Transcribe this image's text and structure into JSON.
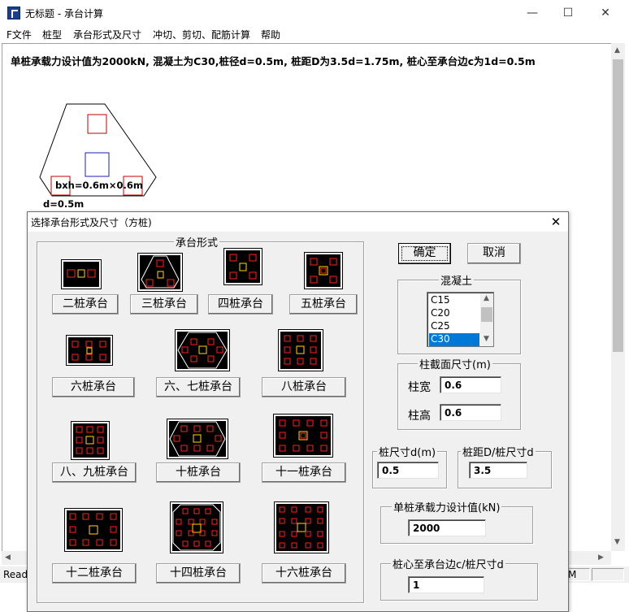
{
  "window": {
    "title": "无标题 - 承台计算",
    "minimize": "—",
    "maximize": "☐",
    "close": "✕"
  },
  "menu": [
    "F文件",
    "桩型",
    "承台形式及尺寸",
    "冲切、剪切、配筋计算",
    "帮助"
  ],
  "info_line": "单桩承载力设计值为2000kN, 混凝土为C30,桩径d=0.5m, 桩距D为3.5d=1.75m, 桩心至承台边c为1d=0.5m",
  "drawing": {
    "column_label": "bxh=0.6m×0.6m",
    "d_label": "d=0.5m",
    "colors": {
      "pile": "#c00000",
      "column": "#1c1cb4",
      "outline": "#000000"
    }
  },
  "statusbar": {
    "text": "Read",
    "cell_text": "M"
  },
  "dialog": {
    "title": "选择承台形式及尺寸（方桩)",
    "close": "✕",
    "group_cap_type": "承台形式",
    "cap_buttons": [
      "二桩承台",
      "三桩承台",
      "四桩承台",
      "五桩承台",
      "六桩承台",
      "六、七桩承台",
      "八桩承台",
      "八、九桩承台",
      "十桩承台",
      "十一桩承台",
      "十二桩承台",
      "十四桩承台",
      "十六桩承台"
    ],
    "ok": "确定",
    "cancel": "取消",
    "group_concrete": "混凝土",
    "concrete_options": [
      "C15",
      "C20",
      "C25",
      "C30"
    ],
    "concrete_selected": "C30",
    "group_column": "柱截面尺寸(m)",
    "column_width_label": "柱宽",
    "column_width_value": "0.6",
    "column_height_label": "柱高",
    "column_height_value": "0.6",
    "group_pile_size": "桩尺寸d(m)",
    "pile_size_value": "0.5",
    "group_spacing": "桩距D/桩尺寸d",
    "spacing_value": "3.5",
    "group_capacity": "单桩承载力设计值(kN)",
    "capacity_value": "2000",
    "group_edge": "桩心至承台边c/桩尺寸d",
    "edge_value": "1",
    "thumb_colors": {
      "bg": "#000000",
      "pile": "#ff2020",
      "column": "#ffd700",
      "outline": "#ffffff"
    }
  }
}
